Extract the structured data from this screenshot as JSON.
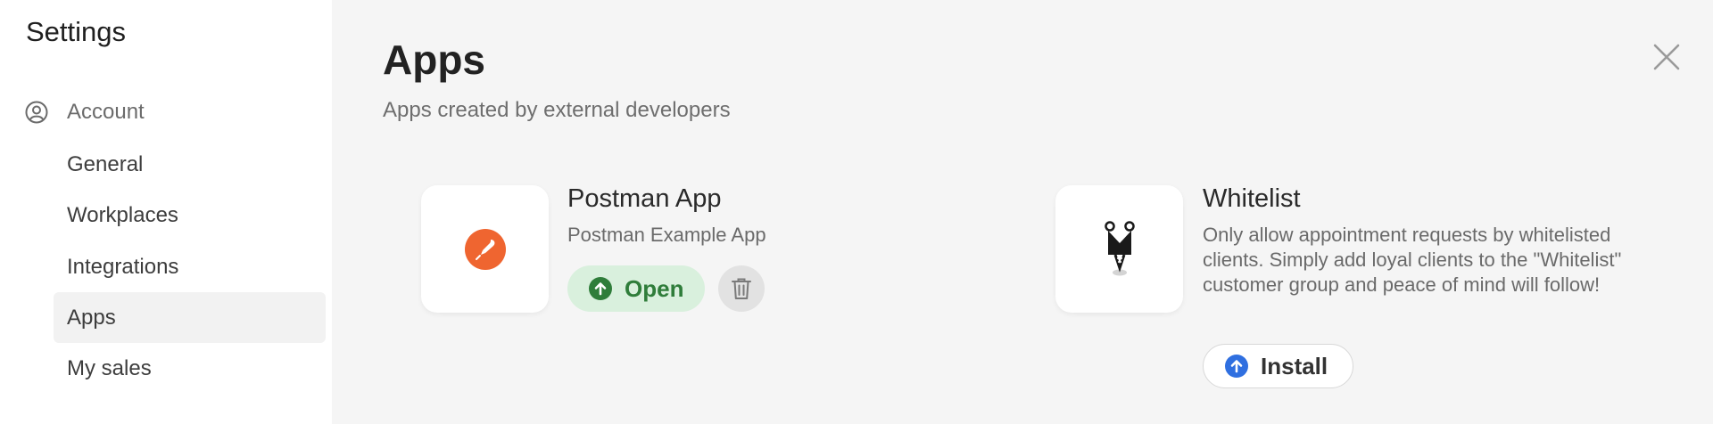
{
  "sidebar": {
    "title": "Settings",
    "section_label": "Account",
    "section_icon": "user-circle-icon",
    "items": [
      {
        "label": "General",
        "active": false
      },
      {
        "label": "Workplaces",
        "active": false
      },
      {
        "label": "Integrations",
        "active": false
      },
      {
        "label": "Apps",
        "active": true
      },
      {
        "label": "My sales",
        "active": false
      }
    ]
  },
  "main": {
    "title": "Apps",
    "subtitle": "Apps created by external developers",
    "close_icon": "close-icon",
    "apps": [
      {
        "name": "Postman App",
        "description": "Postman Example App",
        "icon": "postman-logo",
        "accent": "#ef6530",
        "primary_action": "Open",
        "primary_icon": "upload-circle-icon",
        "primary_color": "#2f7d3a",
        "secondary_icon": "trash-icon"
      },
      {
        "name": "Whitelist",
        "description": "Only allow appointment requests by whitelisted clients. Simply add loyal clients to the \"Whitelist\" customer group and peace of mind will follow!",
        "icon": "whitelist-logo",
        "primary_action": "Install",
        "primary_icon": "upload-circle-icon",
        "primary_color": "#2f6fe0"
      }
    ]
  }
}
